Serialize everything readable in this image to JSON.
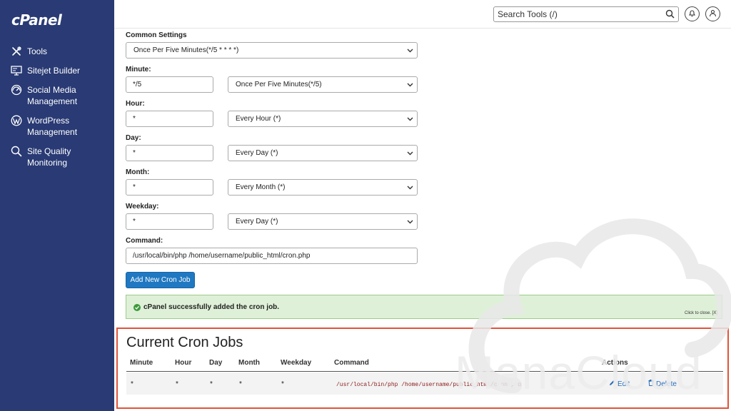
{
  "brand": {
    "logo": "cPanel"
  },
  "sidebar": {
    "items": [
      {
        "label": "Tools",
        "icon": "tools-icon"
      },
      {
        "label": "Sitejet Builder",
        "icon": "monitor-icon"
      },
      {
        "label": "Social Media\nManagement",
        "icon": "gauge-icon"
      },
      {
        "label": "WordPress\nManagement",
        "icon": "wordpress-icon"
      },
      {
        "label": "Site Quality\nMonitoring",
        "icon": "search-icon"
      }
    ]
  },
  "header": {
    "search_value": "Search Tools (/)"
  },
  "form": {
    "common_settings": {
      "label": "Common Settings",
      "value": "Once Per Five Minutes(*/5 * * * *)"
    },
    "minute": {
      "label": "Minute:",
      "value": "*/5",
      "select": "Once Per Five Minutes(*/5)"
    },
    "hour": {
      "label": "Hour:",
      "value": "*",
      "select": "Every Hour (*)"
    },
    "day": {
      "label": "Day:",
      "value": "*",
      "select": "Every Day (*)"
    },
    "month": {
      "label": "Month:",
      "value": "*",
      "select": "Every Month (*)"
    },
    "weekday": {
      "label": "Weekday:",
      "value": "*",
      "select": "Every Day (*)"
    },
    "command": {
      "label": "Command:",
      "value": "/usr/local/bin/php /home/username/public_html/cron.php"
    },
    "add_button": "Add New Cron Job"
  },
  "alert": {
    "message": "cPanel successfully added the cron job.",
    "close_hint": "Click to close. [X]"
  },
  "cron_jobs": {
    "title": "Current Cron Jobs",
    "columns": [
      "Minute",
      "Hour",
      "Day",
      "Month",
      "Weekday",
      "Command",
      "Actions"
    ],
    "rows": [
      {
        "minute": "*",
        "hour": "*",
        "day": "*",
        "month": "*",
        "weekday": "*",
        "command": "/usr/local/bin/php /home/username/public_html/cron.php",
        "edit": "Edit",
        "delete": "Delete"
      }
    ]
  },
  "watermark": {
    "text": "ManaCloud"
  },
  "colors": {
    "sidebar": "#293a74",
    "primary_button": "#1f78c1",
    "success_bg": "#dff0d8",
    "highlight_border": "#e0533a",
    "link": "#2a6ebb",
    "command_text": "#8b1a1a"
  }
}
